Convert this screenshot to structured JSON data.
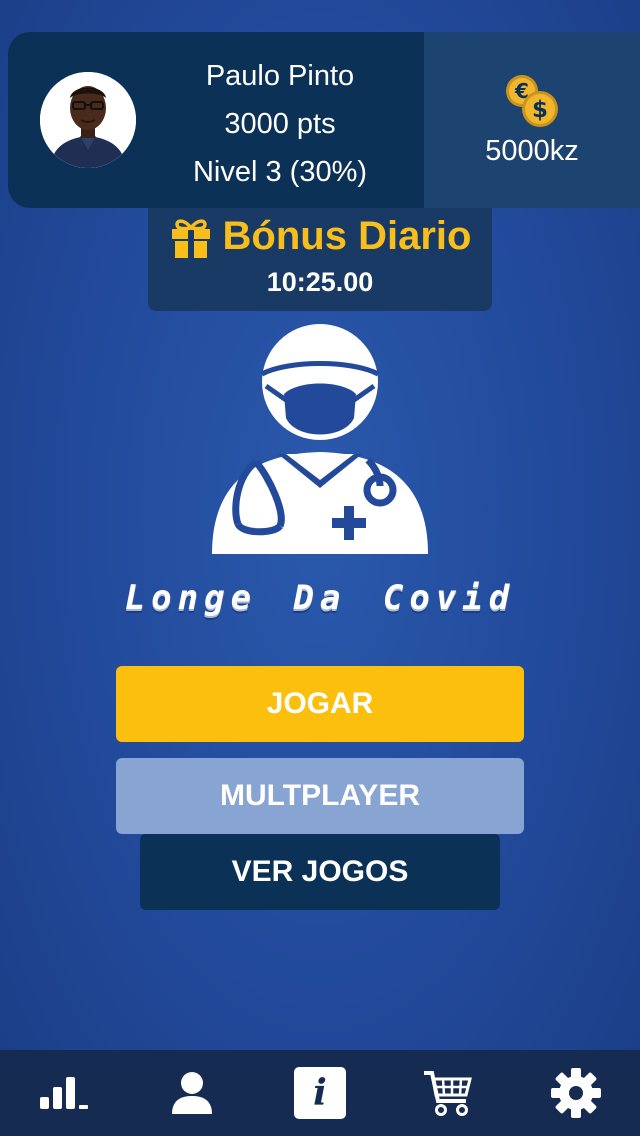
{
  "profile": {
    "name": "Paulo Pinto",
    "points": "3000 pts",
    "level": "Nivel 3 (30%)",
    "level_progress": 0.3
  },
  "wallet": {
    "coins": "5000kz",
    "icon": "coins-icon"
  },
  "bonus": {
    "title": "Bónus Diario",
    "timer": "10:25.00",
    "icon": "gift-icon"
  },
  "game": {
    "title": "Longe Da Covid",
    "logo_icon": "doctor-icon"
  },
  "buttons": {
    "play": "JOGAR",
    "multiplayer": "MULTPLAYER",
    "view_games": "VER JOGOS"
  },
  "nav": [
    {
      "name": "ranking",
      "icon": "bar-chart-icon"
    },
    {
      "name": "profile",
      "icon": "user-icon"
    },
    {
      "name": "info",
      "icon": "info-icon",
      "label": "i",
      "active": true
    },
    {
      "name": "shop",
      "icon": "cart-icon"
    },
    {
      "name": "settings",
      "icon": "gear-icon"
    }
  ],
  "colors": {
    "background": "#22499a",
    "card": "#0c3156",
    "accent": "#fdbf0e",
    "secondary_button": "#87a4d3",
    "nav": "#162b52"
  }
}
